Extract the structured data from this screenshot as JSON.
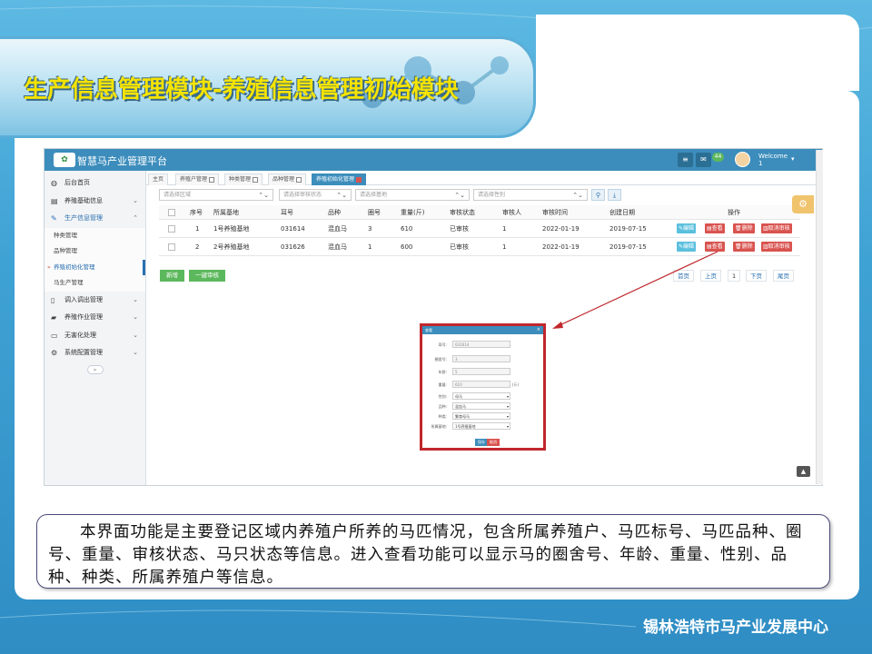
{
  "slide": {
    "title": "生产信息管理模块-养殖信息管理初始模块",
    "description": "本界面功能是主要登记区域内养殖户所养的马匹情况，包含所属养殖户、马匹标号、马匹品种、圈号、重量、审核状态、马只状态等信息。进入查看功能可以显示马的圈舍号、年龄、重量、性别、品种、种类、所属养殖户等信息。",
    "footer_org": "锡林浩特市马产业发展中心"
  },
  "app": {
    "title": "智慧马产业管理平台",
    "header": {
      "badge_count": "44",
      "welcome": "Welcome",
      "user": "1"
    },
    "sidebar": {
      "items": [
        {
          "label": "后台首页",
          "icon": "dashboard-icon"
        },
        {
          "label": "养殖基础信息",
          "icon": "list-icon",
          "chevron": "﹀"
        },
        {
          "label": "生产信息管理",
          "icon": "edit-icon",
          "chevron": "︿"
        },
        {
          "label": "调入调出管理",
          "icon": "file-icon",
          "chevron": "﹀"
        },
        {
          "label": "养殖作业管理",
          "icon": "folder-icon",
          "chevron": "﹀"
        },
        {
          "label": "无害化处理",
          "icon": "monitor-icon",
          "chevron": "﹀"
        },
        {
          "label": "系统配置管理",
          "icon": "cogs-icon",
          "chevron": "﹀"
        }
      ],
      "sub_items": [
        "种类管理",
        "品种管理",
        "养殖初始化管理",
        "马生产管理"
      ],
      "collapse": "»"
    },
    "tabs": [
      "主页",
      "养殖户管理",
      "种类管理",
      "品种管理",
      "养殖初始化管理"
    ],
    "filters": {
      "area": "请选择区域",
      "audit_status": "请选择审核状态",
      "base": "请选择基地",
      "gender": "请选择性别"
    },
    "table": {
      "headers": [
        "序号",
        "所属基地",
        "耳号",
        "品种",
        "圈号",
        "重量(斤)",
        "审核状态",
        "审核人",
        "审核时间",
        "创建日期",
        "操作"
      ],
      "rows": [
        [
          "1",
          "1号养殖基地",
          "031614",
          "混血马",
          "3",
          "610",
          "已审核",
          "1",
          "2022-01-19",
          "2019-07-15"
        ],
        [
          "2",
          "2号养殖基地",
          "031626",
          "混血马",
          "1",
          "600",
          "已审核",
          "1",
          "2022-01-19",
          "2019-07-15"
        ]
      ],
      "row_actions": [
        "编辑",
        "查看",
        "删除",
        "取消审核"
      ]
    },
    "buttons": {
      "add": "新增",
      "audit_all": "一键审核"
    },
    "pager": {
      "first": "首页",
      "prev": "上页",
      "current": "1",
      "next": "下页",
      "last": "尾页"
    }
  },
  "popup": {
    "title": "查看",
    "close": "×",
    "fields": [
      {
        "label": "耳号:",
        "value": "031614"
      },
      {
        "label": "圈舍号:",
        "value": "3"
      },
      {
        "label": "年龄:",
        "value": "5"
      },
      {
        "label": "重量:",
        "value": "610",
        "unit": "(斤)"
      },
      {
        "label": "性别:",
        "value": "母马"
      },
      {
        "label": "品种:",
        "value": "混血马"
      },
      {
        "label": "种类:",
        "value": "繁育母马"
      },
      {
        "label": "所属基地:",
        "value": "1号养殖基地"
      }
    ],
    "save": "保存",
    "cancel": "取消"
  },
  "colors": {
    "title_yellow": "#f5e300",
    "header_blue": "#3c8dbc",
    "highlight_red": "#c0272d",
    "btn_green": "#5cb85c"
  }
}
